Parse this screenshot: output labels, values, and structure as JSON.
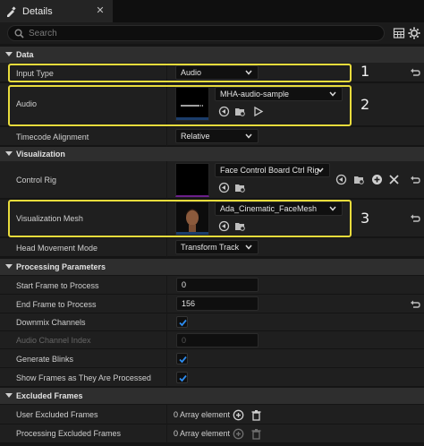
{
  "tab": {
    "title": "Details",
    "close": "✕"
  },
  "search": {
    "placeholder": "Search"
  },
  "categories": {
    "data": "Data",
    "visualization": "Visualization",
    "processing": "Processing Parameters",
    "excluded": "Excluded Frames"
  },
  "rows": {
    "input_type": {
      "label": "Input Type",
      "value": "Audio"
    },
    "audio": {
      "label": "Audio",
      "asset": "MHA-audio-sample"
    },
    "timecode": {
      "label": "Timecode Alignment",
      "value": "Relative"
    },
    "control_rig": {
      "label": "Control Rig",
      "asset": "Face Control Board Ctrl Rig"
    },
    "vis_mesh": {
      "label": "Visualization Mesh",
      "asset": "Ada_Cinematic_FaceMesh"
    },
    "head_mode": {
      "label": "Head Movement Mode",
      "value": "Transform Track"
    },
    "start_frame": {
      "label": "Start Frame to Process",
      "value": "0"
    },
    "end_frame": {
      "label": "End Frame to Process",
      "value": "156"
    },
    "downmix": {
      "label": "Downmix Channels",
      "checked": true
    },
    "audio_channel": {
      "label": "Audio Channel Index",
      "value": "0"
    },
    "gen_blinks": {
      "label": "Generate Blinks",
      "checked": true
    },
    "show_frames": {
      "label": "Show Frames as They Are Processed",
      "checked": true
    },
    "user_excluded": {
      "label": "User Excluded Frames",
      "value": "0 Array element"
    },
    "proc_excluded": {
      "label": "Processing Excluded Frames",
      "value": "0 Array element"
    }
  },
  "callouts": {
    "one": "1",
    "two": "2",
    "three": "3"
  },
  "colors": {
    "highlight": "#e9dc3c",
    "accent": "#1a7cd8",
    "background": "#1f1f1f"
  }
}
